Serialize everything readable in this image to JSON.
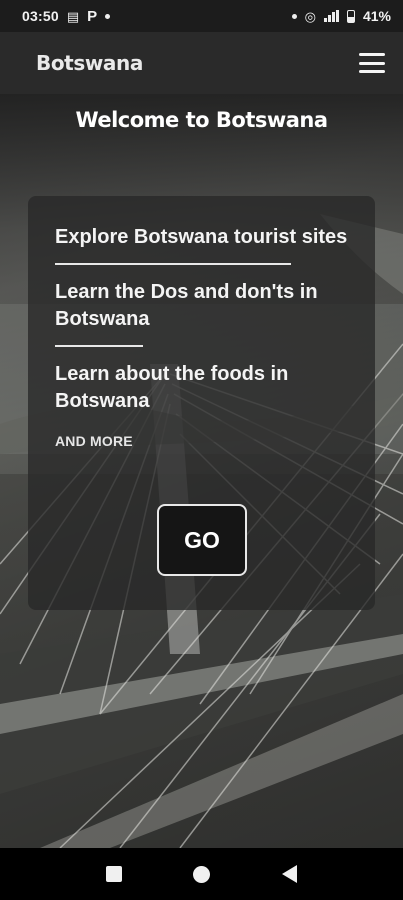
{
  "status_bar": {
    "time": "03:50",
    "p_label": "P",
    "battery": "41%"
  },
  "app_bar": {
    "title": "Botswana"
  },
  "page": {
    "heading": "Welcome to Botswana"
  },
  "card": {
    "items": [
      "Explore Botswana tourist sites",
      "Learn the Dos and don'ts in Botswana",
      "Learn about the foods in Botswana"
    ],
    "more_label": "AND MORE",
    "go_label": "GO"
  },
  "icons": {
    "menu": "hamburger-menu-icon",
    "nav_recents": "square-icon",
    "nav_home": "circle-icon",
    "nav_back": "triangle-back-icon"
  }
}
